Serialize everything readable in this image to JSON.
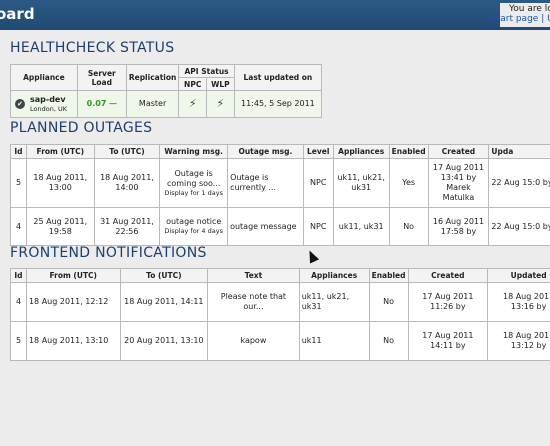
{
  "header": {
    "title": "oard",
    "user_text": "You are log",
    "start_page_link": "Start page",
    "link_sep": "|",
    "partial_link": "U"
  },
  "healthcheck": {
    "title": "HEALTHCHECK STATUS",
    "headers": {
      "appliance": "Appliance",
      "server_load": "Server Load",
      "replication": "Replication",
      "api_status": "API Status",
      "npc": "NPC",
      "wlp": "WLP",
      "last_updated": "Last updated on"
    },
    "rows": [
      {
        "name": "sap-dev",
        "location": "London, UK",
        "load": "0.07",
        "load_suffix": "—",
        "replication": "Master",
        "npc_icon": "connected-plug-icon",
        "wlp_icon": "connected-plug-icon",
        "updated": "11:45, 5 Sep 2011"
      }
    ]
  },
  "outages": {
    "title": "PLANNED OUTAGES",
    "headers": [
      "Id",
      "From (UTC)",
      "To (UTC)",
      "Warning msg.",
      "Outage msg.",
      "Level",
      "Appliances",
      "Enabled",
      "Created",
      "Upda"
    ],
    "rows": [
      {
        "id": "5",
        "from": "18 Aug 2011, 13:00",
        "to": "18 Aug 2011, 14:00",
        "warning": "Outage is coming soo...",
        "warning_note": "Display for 1 days",
        "outage": "Outage is currently ...",
        "level": "NPC",
        "appliances": "uk11, uk21, uk31",
        "enabled": "Yes",
        "created": "17 Aug 2011 13:41 by Marek Matulka",
        "updated": "22 Aug 15:0 by"
      },
      {
        "id": "4",
        "from": "25 Aug 2011, 19:58",
        "to": "31 Aug 2011, 22:56",
        "warning": "outage notice",
        "warning_note": "Display for 4 days",
        "outage": "outage message",
        "level": "NPC",
        "appliances": "uk11, uk31",
        "enabled": "No",
        "created": "16 Aug 2011 17:58 by",
        "updated": "22 Aug 15:0 by"
      }
    ]
  },
  "notifications": {
    "title": "FRONTEND NOTIFICATIONS",
    "headers": [
      "Id",
      "From (UTC)",
      "To (UTC)",
      "Text",
      "Appliances",
      "Enabled",
      "Created",
      "Updated"
    ],
    "rows": [
      {
        "id": "4",
        "from": "18 Aug 2011, 12:12",
        "to": "18 Aug 2011, 14:11",
        "text": "Please note that our...",
        "appliances": "uk11, uk21, uk31",
        "enabled": "No",
        "created": "17 Aug 2011 11:26 by",
        "updated": "18 Aug 2011 13:16 by"
      },
      {
        "id": "5",
        "from": "18 Aug 2011, 13:10",
        "to": "20 Aug 2011, 13:10",
        "text": "kapow",
        "appliances": "uk11",
        "enabled": "No",
        "created": "17 Aug 2011 14:11 by",
        "updated": "18 Aug 2011 13:12 by"
      }
    ]
  }
}
